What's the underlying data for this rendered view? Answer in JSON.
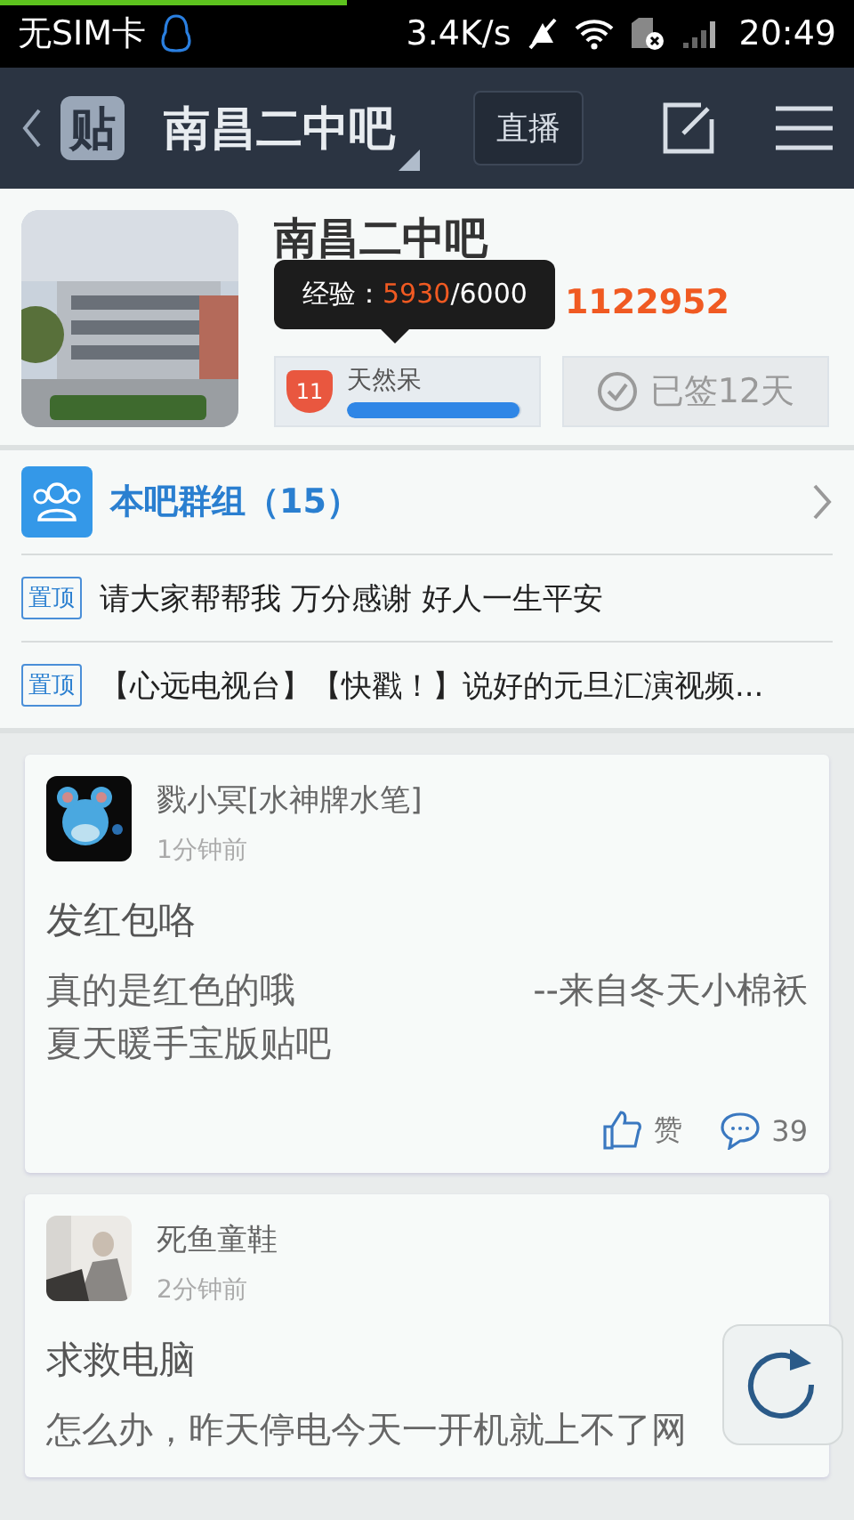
{
  "status_bar": {
    "carrier": "无SIM卡",
    "speed": "3.4K/s",
    "time": "20:49"
  },
  "nav": {
    "logo": "贴",
    "title": "南昌二中吧",
    "live_button": "直播"
  },
  "forum": {
    "name": "南昌二中吧",
    "posts_count": "1122952",
    "tooltip": {
      "label": "经验：",
      "current": "5930",
      "total": "/6000"
    },
    "level_badge": "11",
    "member_title": "天然呆",
    "level": 0.99,
    "sign_button": "已签12天",
    "signed": true
  },
  "group": {
    "label": "本吧群组（15）"
  },
  "pinned": [
    {
      "tag": "置顶",
      "title": "请大家帮帮我 万分感谢 好人一生平安"
    },
    {
      "tag": "置顶",
      "title": "【心远电视台】【快戳！】说好的元旦汇演视频..."
    }
  ],
  "posts": [
    {
      "author": "戮小冥[水神牌水笔]",
      "time": "1分钟前",
      "title": "发红包咯",
      "lines": [
        [
          "真的是红色的哦",
          "--来自冬天小棉袄"
        ],
        [
          "夏天暖手宝版贴吧"
        ]
      ],
      "like": "赞",
      "comments": "39"
    },
    {
      "author": "死鱼童鞋",
      "time": "2分钟前",
      "title": "求救电脑",
      "lines": [
        [
          "怎么办，昨天停电今天一开机就上不了网"
        ]
      ]
    }
  ]
}
